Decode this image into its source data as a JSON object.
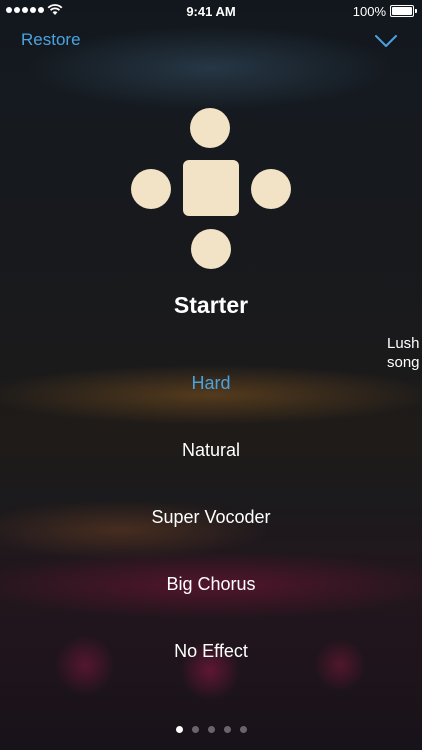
{
  "status_bar": {
    "time": "9:41 AM",
    "battery": "100%"
  },
  "header": {
    "restore_label": "Restore",
    "collapse_icon": "chevron-down-icon"
  },
  "preset": {
    "name": "Starter",
    "icon": "dpad-icon",
    "icon_color": "#f2e3c7"
  },
  "next_preset_peek": {
    "line1": "Lush",
    "line2": "song"
  },
  "effects": {
    "options": [
      {
        "label": "Hard",
        "selected": true
      },
      {
        "label": "Natural",
        "selected": false
      },
      {
        "label": "Super Vocoder",
        "selected": false
      },
      {
        "label": "Big Chorus",
        "selected": false
      },
      {
        "label": "No Effect",
        "selected": false
      }
    ]
  },
  "pagination": {
    "total": 5,
    "current": 1
  },
  "colors": {
    "accent": "#4aa3df",
    "text": "#ffffff"
  }
}
